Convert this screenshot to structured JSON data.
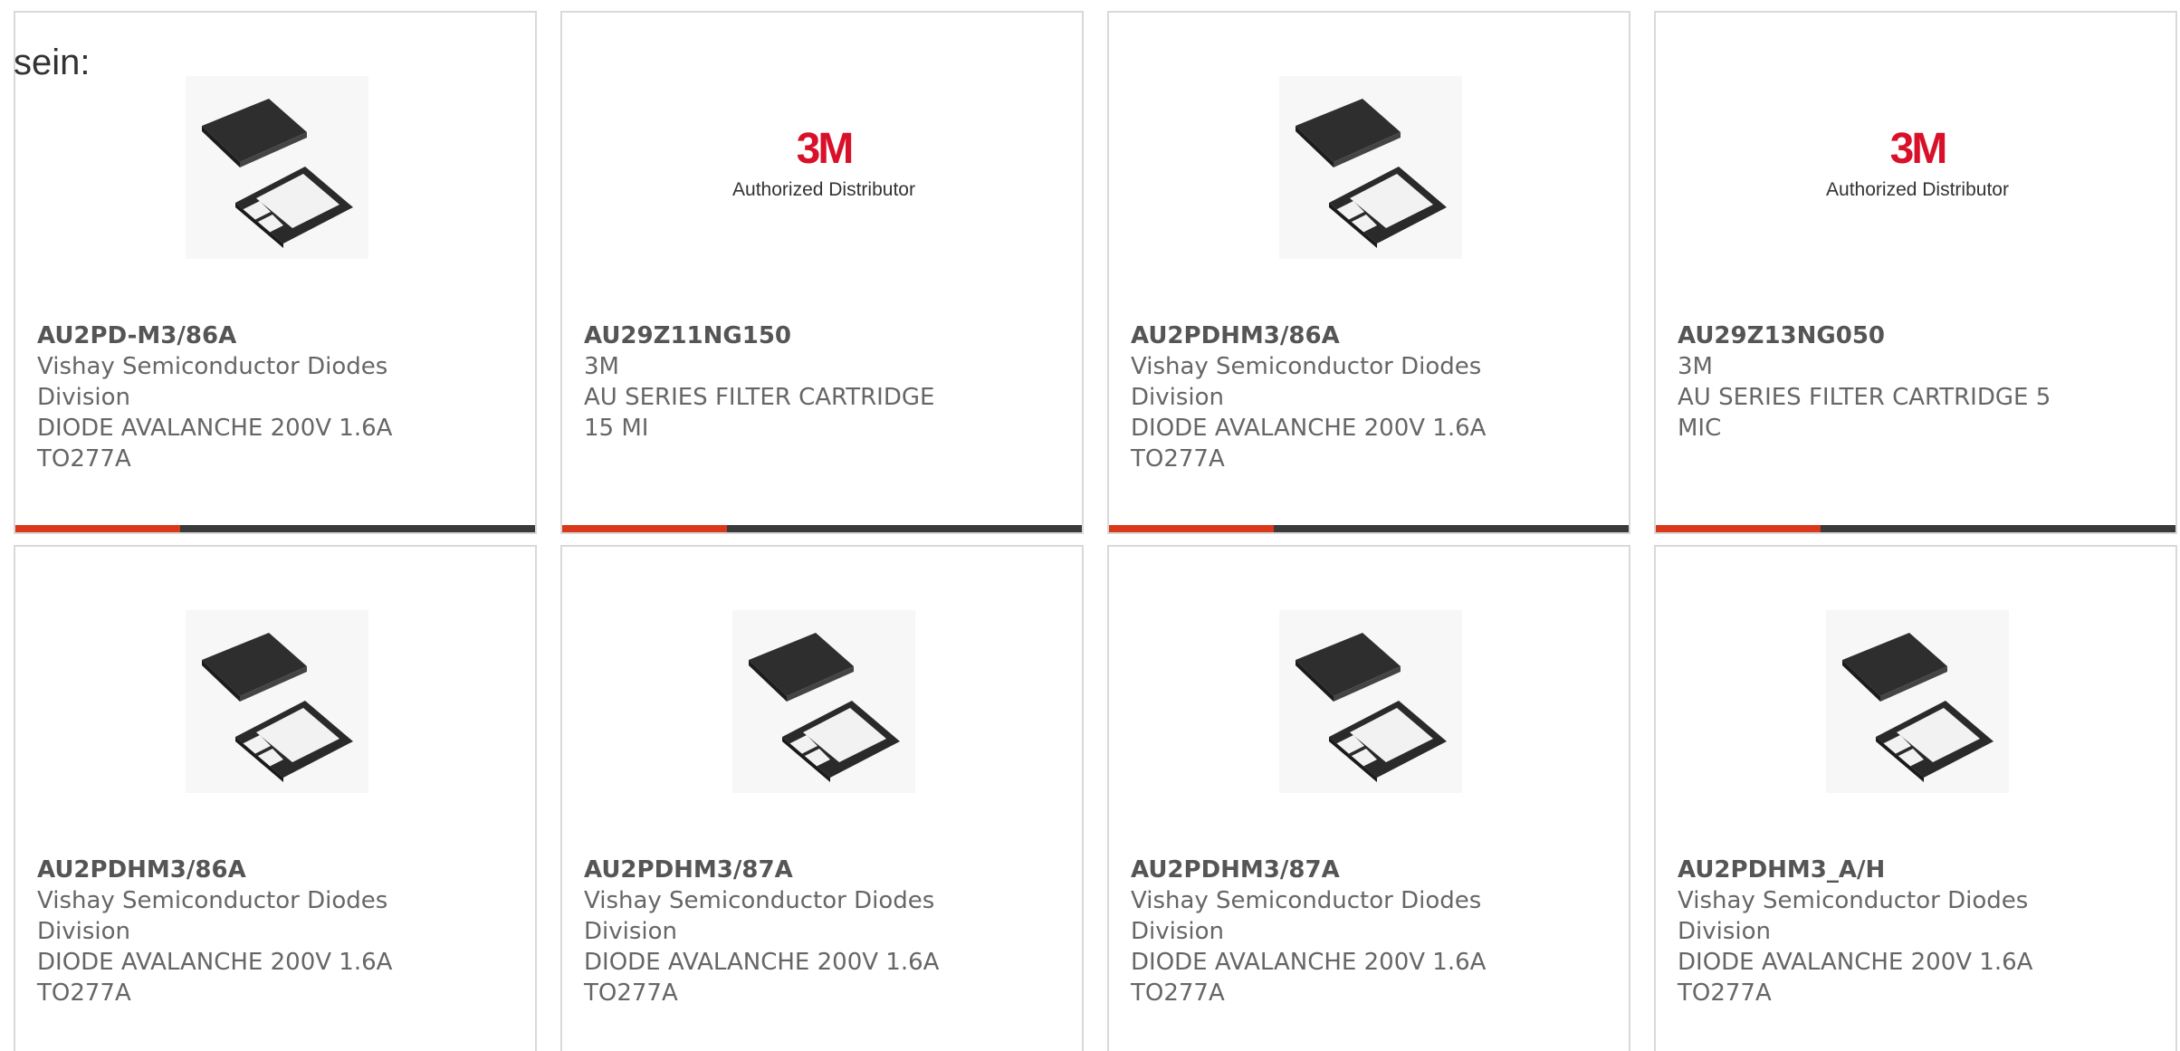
{
  "intro_text": "sein:",
  "colors": {
    "accent": "#d9391a",
    "bar": "#3a3a3a",
    "logo_red": "#d9102a",
    "border": "#d9d9d9"
  },
  "products": [
    {
      "part_number": "AU2PD-M3/86A",
      "lines": [
        "Vishay Semiconductor Diodes",
        "Division",
        "DIODE AVALANCHE 200V 1.6A",
        "TO277A"
      ],
      "image": "diode-package-image"
    },
    {
      "part_number": "AU29Z11NG150",
      "lines": [
        "3M",
        "AU SERIES FILTER CARTRIDGE",
        "15 MI",
        ""
      ],
      "image": "3m-logo",
      "logo_text": "3M",
      "logo_caption": "Authorized Distributor"
    },
    {
      "part_number": "AU2PDHM3/86A",
      "lines": [
        "Vishay Semiconductor Diodes",
        "Division",
        "DIODE AVALANCHE 200V 1.6A",
        "TO277A"
      ],
      "image": "diode-package-image"
    },
    {
      "part_number": "AU29Z13NG050",
      "lines": [
        "3M",
        "AU SERIES FILTER CARTRIDGE 5",
        "MIC",
        ""
      ],
      "image": "3m-logo",
      "logo_text": "3M",
      "logo_caption": "Authorized Distributor"
    },
    {
      "part_number": "AU2PDHM3/86A",
      "lines": [
        "Vishay Semiconductor Diodes",
        "Division",
        "DIODE AVALANCHE 200V 1.6A",
        "TO277A"
      ],
      "image": "diode-package-image"
    },
    {
      "part_number": "AU2PDHM3/87A",
      "lines": [
        "Vishay Semiconductor Diodes",
        "Division",
        "DIODE AVALANCHE 200V 1.6A",
        "TO277A"
      ],
      "image": "diode-package-image"
    },
    {
      "part_number": "AU2PDHM3/87A",
      "lines": [
        "Vishay Semiconductor Diodes",
        "Division",
        "DIODE AVALANCHE 200V 1.6A",
        "TO277A"
      ],
      "image": "diode-package-image"
    },
    {
      "part_number": "AU2PDHM3_A/H",
      "lines": [
        "Vishay Semiconductor Diodes",
        "Division",
        "DIODE AVALANCHE 200V 1.6A",
        "TO277A"
      ],
      "image": "diode-package-image"
    }
  ]
}
